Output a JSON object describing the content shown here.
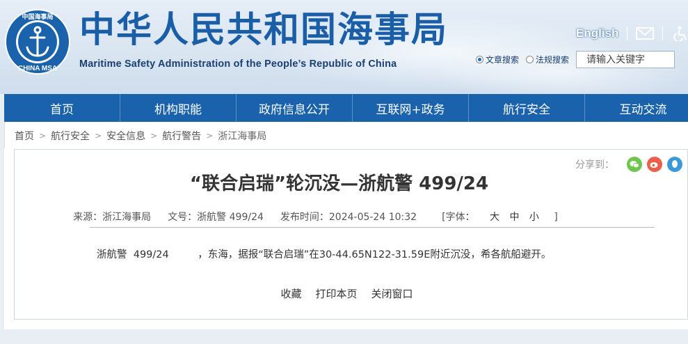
{
  "header": {
    "logo": {
      "icon": "anchor-emblem-icon",
      "ring_text": "中国海事局",
      "bottom_text": "CHINA MSA"
    },
    "title": "中华人民共和国海事局",
    "subtitle": "Maritime Safety Administration of the People’s Republic of China",
    "english_link": "English",
    "mail_icon": "mail-icon",
    "accessibility_icon": "accessibility-icon"
  },
  "search": {
    "options": [
      {
        "label": "文章搜索",
        "selected": true
      },
      {
        "label": "法规搜索",
        "selected": false
      }
    ],
    "placeholder": "请输入关键字"
  },
  "nav": {
    "items": [
      "首页",
      "机构职能",
      "政府信息公开",
      "互联网+政务",
      "航行安全",
      "互动交流"
    ]
  },
  "breadcrumb": [
    "首页",
    "航行安全",
    "安全信息",
    "航行警告",
    "浙江海事局"
  ],
  "article": {
    "share_label": "分享到：",
    "share_icons": [
      "wechat-icon",
      "weibo-icon",
      "qq-icon"
    ],
    "title": "“联合启瑞”轮沉没—浙航警 499/24",
    "meta": {
      "source": "来源：浙江海事局",
      "doc_no": "文号：浙航警 499/24",
      "published": "发布时间：2024-05-24 10:32",
      "font_label": "[字体：",
      "font_large": "大",
      "font_medium": "中",
      "font_small": "小",
      "font_close": "]"
    },
    "body": "浙航警  499/24         ，东海，据报“联合启瑞”在30-44.65N122-31.59E附近沉没，希各航船避开。",
    "actions": [
      "收藏",
      "打印本页",
      "关闭窗口"
    ]
  },
  "colors": {
    "brand_blue": "#1b5ea8",
    "nav_blue": "#1a63ac"
  }
}
